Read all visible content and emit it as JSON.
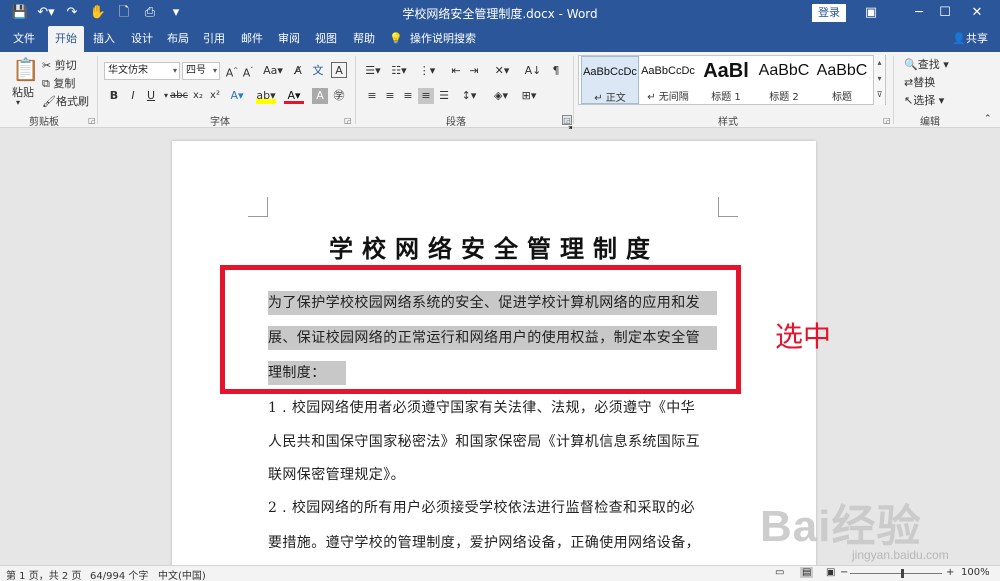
{
  "titlebar": {
    "title": "学校网络安全管理制度.docx - Word",
    "login_label": "登录",
    "quick_access": [
      "save-icon",
      "undo-icon",
      "redo-icon",
      "touch-mode-icon",
      "new-document-icon",
      "print-preview-icon",
      "customize-icon"
    ]
  },
  "tabs": [
    "文件",
    "开始",
    "插入",
    "设计",
    "布局",
    "引用",
    "邮件",
    "审阅",
    "视图",
    "帮助"
  ],
  "active_tab": "开始",
  "tell_me": "操作说明搜索",
  "share_label": "共享",
  "ribbon": {
    "clipboard": {
      "label": "剪贴板",
      "paste": "粘贴",
      "cut": "剪切",
      "copy": "复制",
      "format_painter": "格式刷"
    },
    "font": {
      "label": "字体",
      "font_name": "华文仿宋",
      "font_size": "四号"
    },
    "paragraph": {
      "label": "段落"
    },
    "styles": {
      "label": "样式",
      "items": [
        {
          "sample": "AaBbCcDc",
          "name": "↵ 正文"
        },
        {
          "sample": "AaBbCcDc",
          "name": "↵ 无间隔"
        },
        {
          "sample": "AaBl",
          "name": "标题 1"
        },
        {
          "sample": "AaBbC",
          "name": "标题 2"
        },
        {
          "sample": "AaBbC",
          "name": "标题"
        }
      ]
    },
    "editing": {
      "label": "编辑",
      "find": "查找",
      "replace": "替换",
      "select": "选择"
    }
  },
  "document": {
    "heading": "学校网络安全管理制度",
    "lines": [
      {
        "text": "为了保护学校校园网络系统的安全、促进学校计算机网络的应用和发",
        "selected": true
      },
      {
        "text": "展、保证校园网络的正常运行和网络用户的使用权益，制定本安全管",
        "selected": true
      },
      {
        "text": "理制度：",
        "selected": true
      },
      {
        "text": "1 . 校园网络使用者必须遵守国家有关法律、法规，必须遵守《中华",
        "selected": false
      },
      {
        "text": "人民共和国保守国家秘密法》和国家保密局《计算机信息系统国际互",
        "selected": false
      },
      {
        "text": "联网保密管理规定》。",
        "selected": false
      },
      {
        "text": "2 . 校园网络的所有用户必须接受学校依法进行监督检查和采取的必",
        "selected": false
      },
      {
        "text": "要措施。遵守学校的管理制度，爱护网络设备，正确使用网络设备，",
        "selected": false
      }
    ]
  },
  "annotation": {
    "label": "选中",
    "color": "#e3142b"
  },
  "watermark": {
    "text": "Bai经验",
    "url": "jingyan.baidu.com"
  },
  "statusbar": {
    "page": "第 1 页，共 2 页",
    "words": "64/994 个字",
    "language": "中文(中国)",
    "zoom": "100%"
  },
  "colors": {
    "accent": "#2b579a",
    "selection": "#c8c8c8"
  }
}
